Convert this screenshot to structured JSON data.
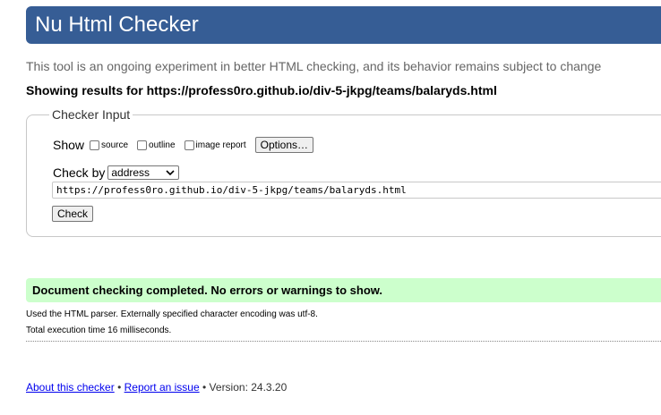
{
  "header": {
    "title": "Nu Html Checker"
  },
  "intro": "This tool is an ongoing experiment in better HTML checking, and its behavior remains subject to change",
  "results_line": "Showing results for https://profess0ro.github.io/div-5-jkpg/teams/balaryds.html",
  "checker_input": {
    "legend": "Checker Input",
    "show_label": "Show",
    "options": {
      "source": "source",
      "outline": "outline",
      "image_report": "image report"
    },
    "options_button": "Options…",
    "check_by_label": "Check by",
    "check_by_value": "address",
    "url_value": "https://profess0ro.github.io/div-5-jkpg/teams/balaryds.html",
    "check_button": "Check"
  },
  "result": {
    "success_message": "Document checking completed. No errors or warnings to show.",
    "parser_note": "Used the HTML parser. Externally specified character encoding was utf-8.",
    "execution_time": "Total execution time 16 milliseconds."
  },
  "footer": {
    "about_link": "About this checker",
    "separator": "•",
    "report_link": "Report an issue",
    "version": "Version: 24.3.20"
  },
  "colors": {
    "header_bg": "#365d95",
    "success_bg": "#ccffcc",
    "link": "#0000ee"
  }
}
